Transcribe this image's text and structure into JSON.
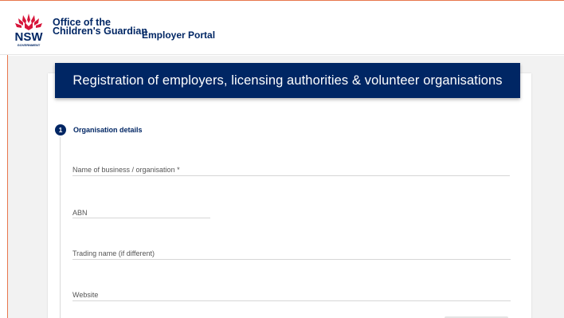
{
  "header": {
    "logo": {
      "text": "NSW",
      "subtext": "GOVERNMENT",
      "name_line1": "Office of the",
      "name_line2": "Children's Guardian",
      "icon": "waratah-flower-icon"
    },
    "portal_title": "Employer Portal"
  },
  "colors": {
    "brand_navy": "#002664",
    "brand_red": "#d7153a",
    "accent_orange": "#e8774d"
  },
  "banner": {
    "title": "Registration of employers, licensing authorities & volunteer organisations"
  },
  "step": {
    "number": "1",
    "title": "Organisation details"
  },
  "form": {
    "fields": [
      {
        "label": "Name of business / organisation *",
        "value": ""
      },
      {
        "label": "ABN",
        "value": ""
      },
      {
        "label": "Trading name (if different)",
        "value": ""
      },
      {
        "label": "Website",
        "value": ""
      }
    ]
  }
}
